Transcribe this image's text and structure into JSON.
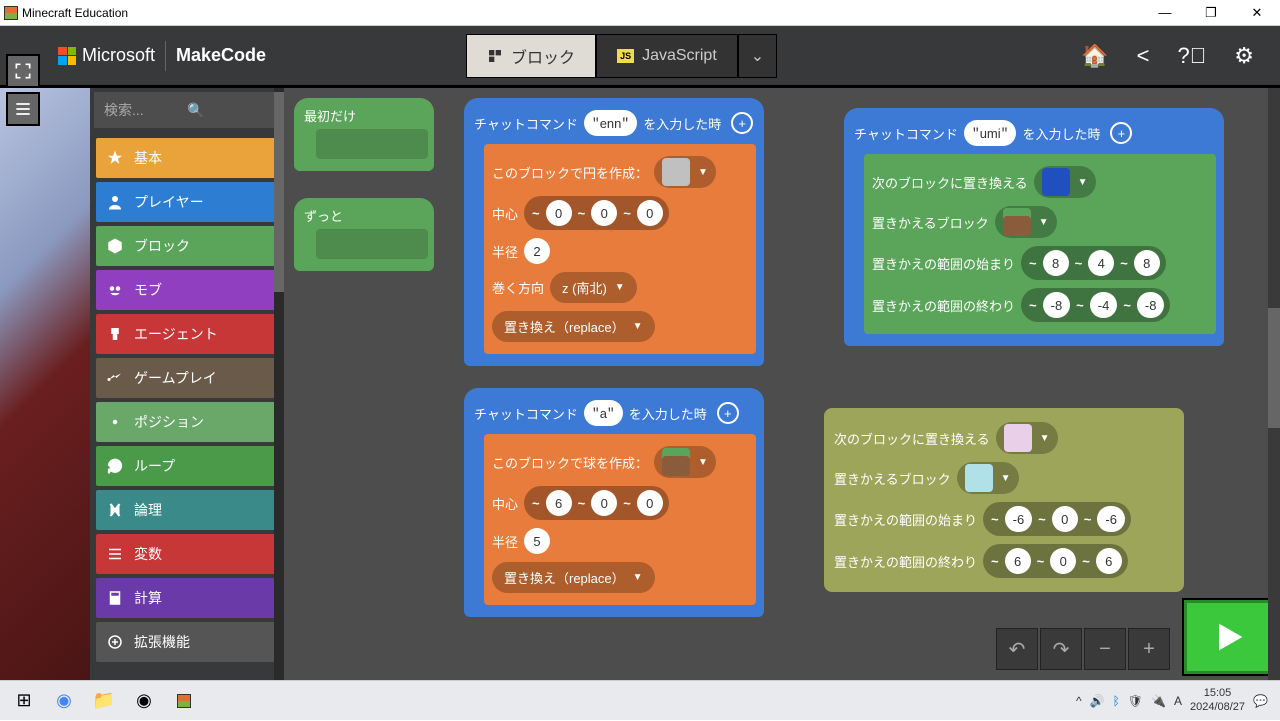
{
  "window": {
    "title": "Minecraft Education"
  },
  "brand": {
    "ms": "Microsoft",
    "product": "MakeCode"
  },
  "tabs": {
    "blocks": "ブロック",
    "js": "JavaScript"
  },
  "search": {
    "placeholder": "検索..."
  },
  "categories": [
    {
      "label": "基本",
      "color": "#e9a33a"
    },
    {
      "label": "プレイヤー",
      "color": "#2d7dd2"
    },
    {
      "label": "ブロック",
      "color": "#5ba55b"
    },
    {
      "label": "モブ",
      "color": "#8f3fbf"
    },
    {
      "label": "エージェント",
      "color": "#c83737"
    },
    {
      "label": "ゲームプレイ",
      "color": "#6a5a4a"
    },
    {
      "label": "ポジション",
      "color": "#6aa86a"
    },
    {
      "label": "ループ",
      "color": "#4a9a4a"
    },
    {
      "label": "論理",
      "color": "#3a8a8a"
    },
    {
      "label": "変数",
      "color": "#c83737"
    },
    {
      "label": "計算",
      "color": "#6a3aa8"
    },
    {
      "label": "拡張機能",
      "color": "#555"
    }
  ],
  "blocks": {
    "onstart": "最初だけ",
    "forever": "ずっと",
    "chat_cmd_prefix": "チャットコマンド",
    "chat_cmd_suffix": "を入力した時",
    "enn": {
      "cmd": "enn",
      "create_circle": "このブロックで円を作成：",
      "center": "中心",
      "c": [
        "0",
        "0",
        "0"
      ],
      "radius_label": "半径",
      "radius": "2",
      "axis_label": "巻く方向",
      "axis": "z (南北)",
      "mode": "置き換え（replace）"
    },
    "a": {
      "cmd": "a",
      "create_sphere": "このブロックで球を作成：",
      "center": "中心",
      "c": [
        "6",
        "0",
        "0"
      ],
      "radius_label": "半径",
      "radius": "5",
      "mode": "置き換え（replace）"
    },
    "umi": {
      "cmd": "umi",
      "replace_to": "次のブロックに置き換える",
      "replace_from": "置きかえるブロック",
      "range_start": "置きかえの範囲の始まり",
      "start": [
        "8",
        "4",
        "8"
      ],
      "range_end": "置きかえの範囲の終わり",
      "end": [
        "-8",
        "-4",
        "-8"
      ]
    },
    "free": {
      "replace_to": "次のブロックに置き換える",
      "replace_from": "置きかえるブロック",
      "range_start": "置きかえの範囲の始まり",
      "start": [
        "-6",
        "0",
        "-6"
      ],
      "range_end": "置きかえの範囲の終わり",
      "end": [
        "6",
        "0",
        "6"
      ]
    }
  },
  "taskbar": {
    "time": "15:05",
    "date": "2024/08/27"
  }
}
